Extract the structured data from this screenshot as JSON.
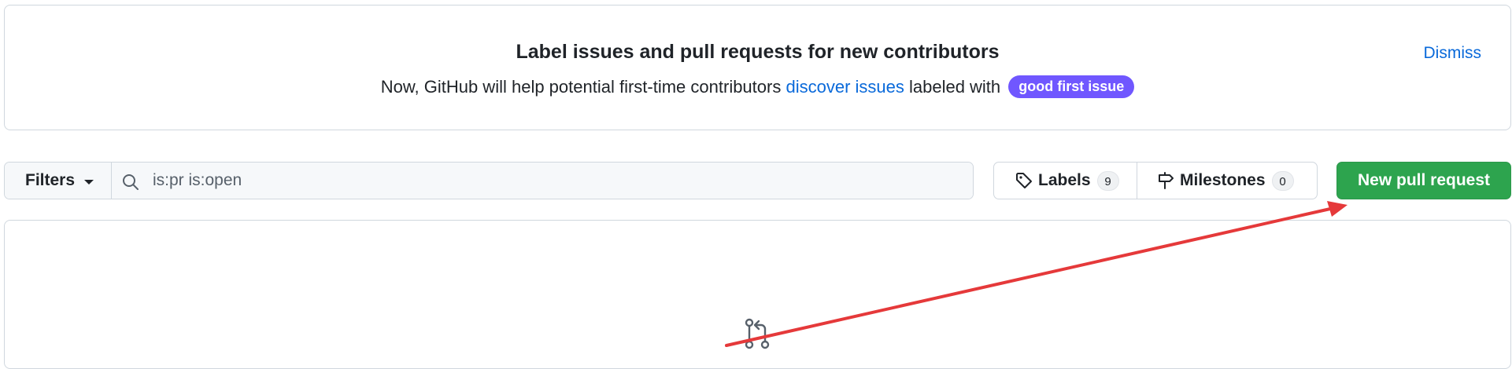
{
  "banner": {
    "title": "Label issues and pull requests for new contributors",
    "desc_prefix": "Now, GitHub will help potential first-time contributors ",
    "desc_link": "discover issues",
    "desc_middle": " labeled with ",
    "label_pill": "good first issue",
    "dismiss": "Dismiss"
  },
  "toolbar": {
    "filters_label": "Filters",
    "search_value": "is:pr is:open",
    "labels_label": "Labels",
    "labels_count": "9",
    "milestones_label": "Milestones",
    "milestones_count": "0",
    "new_pr_label": "New pull request"
  },
  "colors": {
    "accent_link": "#0969da",
    "label_pill": "#7057ff",
    "primary_button": "#2da44e",
    "annotation_arrow": "#e5393a"
  },
  "icons": {
    "search": "search-icon",
    "tag": "tag-icon",
    "milestone": "milestone-icon",
    "pull_request": "git-pull-request-icon"
  }
}
